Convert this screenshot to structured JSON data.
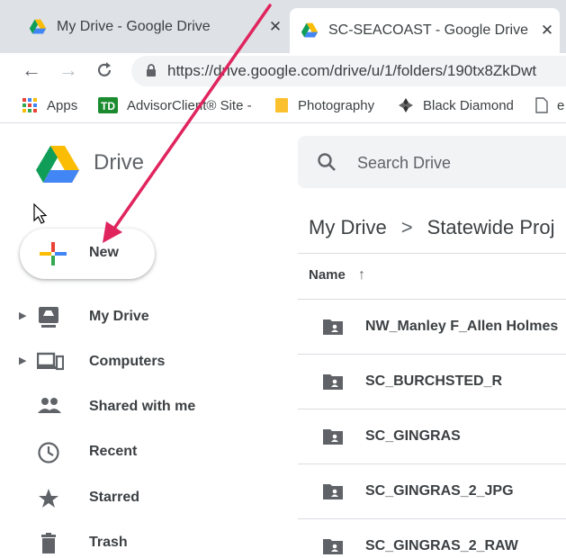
{
  "browser": {
    "tabs": [
      {
        "title": "My Drive - Google Drive",
        "close": "✕"
      },
      {
        "title": "SC-SEACOAST - Google Drive",
        "close": "✕"
      }
    ],
    "url": "https://drive.google.com/drive/u/1/folders/190tx8ZkDwt",
    "bookmarks": [
      {
        "label": "Apps",
        "icon": "apps-grid-icon"
      },
      {
        "label": "AdvisorClient® Site -",
        "icon": "td-icon"
      },
      {
        "label": "Photography",
        "icon": "folder-icon"
      },
      {
        "label": "Black Diamond",
        "icon": "diamond-icon"
      },
      {
        "label": "e",
        "icon": "page-icon"
      }
    ]
  },
  "drive": {
    "brand": "Drive",
    "search_placeholder": "Search Drive",
    "new_label": "New",
    "sidebar": [
      {
        "label": "My Drive",
        "icon": "my-drive-icon",
        "expandable": true
      },
      {
        "label": "Computers",
        "icon": "computers-icon",
        "expandable": true
      },
      {
        "label": "Shared with me",
        "icon": "shared-icon",
        "expandable": false
      },
      {
        "label": "Recent",
        "icon": "clock-icon",
        "expandable": false
      },
      {
        "label": "Starred",
        "icon": "star-icon",
        "expandable": false
      },
      {
        "label": "Trash",
        "icon": "trash-icon",
        "expandable": false
      }
    ],
    "breadcrumb": {
      "root": "My Drive",
      "separator": ">",
      "current": "Statewide Proj"
    },
    "column_header": "Name",
    "sort_icon": "↑",
    "files": [
      "NW_Manley F_Allen Holmes",
      "SC_BURCHSTED_R",
      "SC_GINGRAS",
      "SC_GINGRAS_2_JPG",
      "SC_GINGRAS_2_RAW"
    ]
  },
  "colors": {
    "accent_arrow": "#e0245e",
    "text": "#3c4043",
    "icon": "#5f6368"
  }
}
